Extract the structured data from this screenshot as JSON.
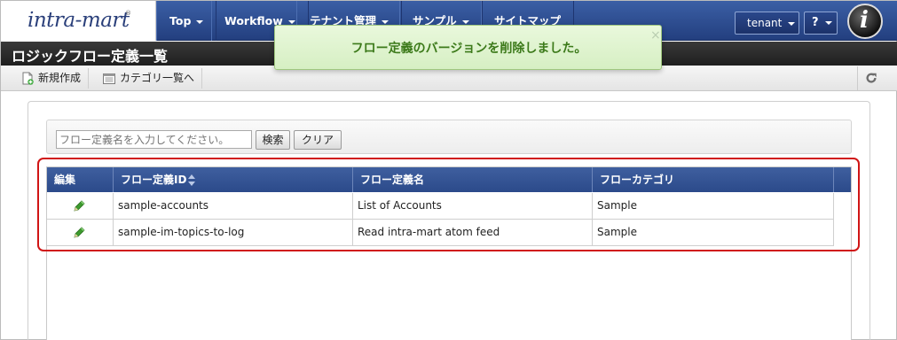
{
  "app": {
    "logo_text": "intra-mart",
    "logo_reg": "®"
  },
  "nav": {
    "items": [
      {
        "label": "Top"
      },
      {
        "label": "Workflow"
      },
      {
        "label": "テナント管理"
      },
      {
        "label": "サンプル"
      },
      {
        "label": "サイトマップ"
      }
    ],
    "tenant": "tenant",
    "help": "?"
  },
  "page": {
    "title": "ロジックフロー定義一覧"
  },
  "toolbar": {
    "new_label": "新規作成",
    "category_label": "カテゴリ一覧へ"
  },
  "notification": {
    "message": "フロー定義のバージョンを削除しました。",
    "close": "×"
  },
  "search": {
    "placeholder": "フロー定義名を入力してください。",
    "search_label": "検索",
    "clear_label": "クリア"
  },
  "grid": {
    "columns": [
      "編集",
      "フロー定義ID",
      "フロー定義名",
      "フローカテゴリ"
    ],
    "rows": [
      {
        "id": "sample-accounts",
        "name": "List of Accounts",
        "category": "Sample"
      },
      {
        "id": "sample-im-topics-to-log",
        "name": "Read intra-mart atom feed",
        "category": "Sample"
      }
    ]
  },
  "colors": {
    "nav_bg": "#2f4f93",
    "title_bg": "#2a2a2a",
    "notice_bg": "#e0f3cf",
    "notice_text": "#3c7a1a",
    "grid_header": "#365596",
    "highlight": "#d01515"
  }
}
